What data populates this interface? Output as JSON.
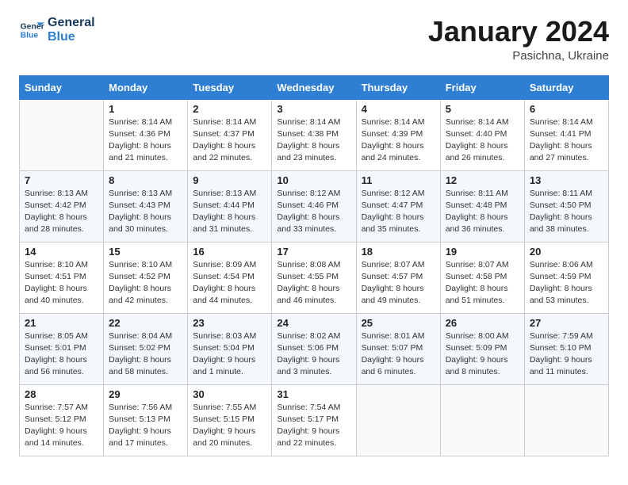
{
  "header": {
    "logo_line1": "General",
    "logo_line2": "Blue",
    "month_year": "January 2024",
    "location": "Pasichna, Ukraine"
  },
  "days_of_week": [
    "Sunday",
    "Monday",
    "Tuesday",
    "Wednesday",
    "Thursday",
    "Friday",
    "Saturday"
  ],
  "weeks": [
    [
      {
        "day": null
      },
      {
        "day": "1",
        "sunrise": "8:14 AM",
        "sunset": "4:36 PM",
        "daylight": "8 hours and 21 minutes."
      },
      {
        "day": "2",
        "sunrise": "8:14 AM",
        "sunset": "4:37 PM",
        "daylight": "8 hours and 22 minutes."
      },
      {
        "day": "3",
        "sunrise": "8:14 AM",
        "sunset": "4:38 PM",
        "daylight": "8 hours and 23 minutes."
      },
      {
        "day": "4",
        "sunrise": "8:14 AM",
        "sunset": "4:39 PM",
        "daylight": "8 hours and 24 minutes."
      },
      {
        "day": "5",
        "sunrise": "8:14 AM",
        "sunset": "4:40 PM",
        "daylight": "8 hours and 26 minutes."
      },
      {
        "day": "6",
        "sunrise": "8:14 AM",
        "sunset": "4:41 PM",
        "daylight": "8 hours and 27 minutes."
      }
    ],
    [
      {
        "day": "7",
        "sunrise": "8:13 AM",
        "sunset": "4:42 PM",
        "daylight": "8 hours and 28 minutes."
      },
      {
        "day": "8",
        "sunrise": "8:13 AM",
        "sunset": "4:43 PM",
        "daylight": "8 hours and 30 minutes."
      },
      {
        "day": "9",
        "sunrise": "8:13 AM",
        "sunset": "4:44 PM",
        "daylight": "8 hours and 31 minutes."
      },
      {
        "day": "10",
        "sunrise": "8:12 AM",
        "sunset": "4:46 PM",
        "daylight": "8 hours and 33 minutes."
      },
      {
        "day": "11",
        "sunrise": "8:12 AM",
        "sunset": "4:47 PM",
        "daylight": "8 hours and 35 minutes."
      },
      {
        "day": "12",
        "sunrise": "8:11 AM",
        "sunset": "4:48 PM",
        "daylight": "8 hours and 36 minutes."
      },
      {
        "day": "13",
        "sunrise": "8:11 AM",
        "sunset": "4:50 PM",
        "daylight": "8 hours and 38 minutes."
      }
    ],
    [
      {
        "day": "14",
        "sunrise": "8:10 AM",
        "sunset": "4:51 PM",
        "daylight": "8 hours and 40 minutes."
      },
      {
        "day": "15",
        "sunrise": "8:10 AM",
        "sunset": "4:52 PM",
        "daylight": "8 hours and 42 minutes."
      },
      {
        "day": "16",
        "sunrise": "8:09 AM",
        "sunset": "4:54 PM",
        "daylight": "8 hours and 44 minutes."
      },
      {
        "day": "17",
        "sunrise": "8:08 AM",
        "sunset": "4:55 PM",
        "daylight": "8 hours and 46 minutes."
      },
      {
        "day": "18",
        "sunrise": "8:07 AM",
        "sunset": "4:57 PM",
        "daylight": "8 hours and 49 minutes."
      },
      {
        "day": "19",
        "sunrise": "8:07 AM",
        "sunset": "4:58 PM",
        "daylight": "8 hours and 51 minutes."
      },
      {
        "day": "20",
        "sunrise": "8:06 AM",
        "sunset": "4:59 PM",
        "daylight": "8 hours and 53 minutes."
      }
    ],
    [
      {
        "day": "21",
        "sunrise": "8:05 AM",
        "sunset": "5:01 PM",
        "daylight": "8 hours and 56 minutes."
      },
      {
        "day": "22",
        "sunrise": "8:04 AM",
        "sunset": "5:02 PM",
        "daylight": "8 hours and 58 minutes."
      },
      {
        "day": "23",
        "sunrise": "8:03 AM",
        "sunset": "5:04 PM",
        "daylight": "9 hours and 1 minute."
      },
      {
        "day": "24",
        "sunrise": "8:02 AM",
        "sunset": "5:06 PM",
        "daylight": "9 hours and 3 minutes."
      },
      {
        "day": "25",
        "sunrise": "8:01 AM",
        "sunset": "5:07 PM",
        "daylight": "9 hours and 6 minutes."
      },
      {
        "day": "26",
        "sunrise": "8:00 AM",
        "sunset": "5:09 PM",
        "daylight": "9 hours and 8 minutes."
      },
      {
        "day": "27",
        "sunrise": "7:59 AM",
        "sunset": "5:10 PM",
        "daylight": "9 hours and 11 minutes."
      }
    ],
    [
      {
        "day": "28",
        "sunrise": "7:57 AM",
        "sunset": "5:12 PM",
        "daylight": "9 hours and 14 minutes."
      },
      {
        "day": "29",
        "sunrise": "7:56 AM",
        "sunset": "5:13 PM",
        "daylight": "9 hours and 17 minutes."
      },
      {
        "day": "30",
        "sunrise": "7:55 AM",
        "sunset": "5:15 PM",
        "daylight": "9 hours and 20 minutes."
      },
      {
        "day": "31",
        "sunrise": "7:54 AM",
        "sunset": "5:17 PM",
        "daylight": "9 hours and 22 minutes."
      },
      {
        "day": null
      },
      {
        "day": null
      },
      {
        "day": null
      }
    ]
  ],
  "labels": {
    "sunrise": "Sunrise:",
    "sunset": "Sunset:",
    "daylight": "Daylight:"
  }
}
